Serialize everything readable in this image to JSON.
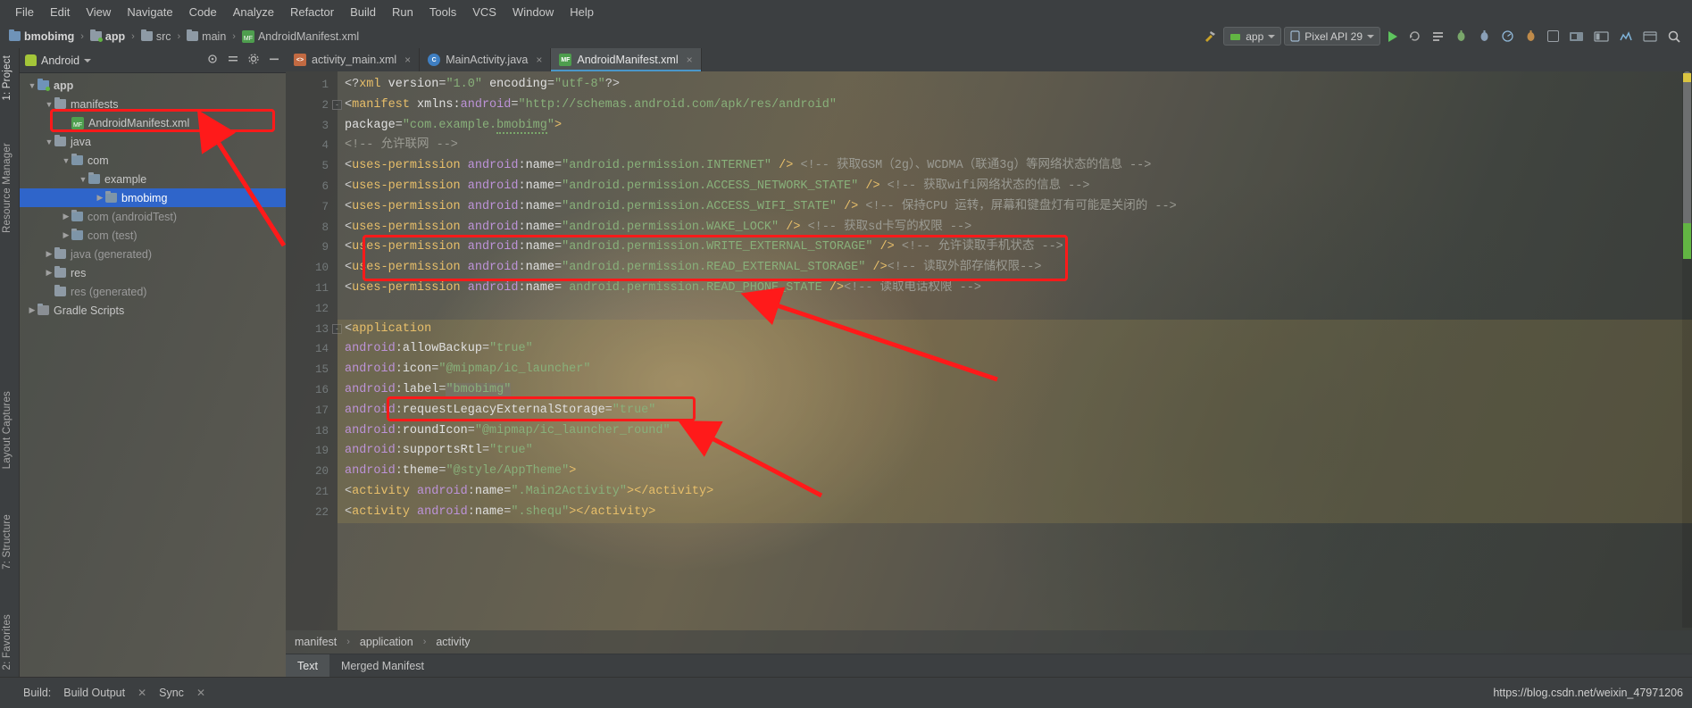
{
  "menu": {
    "items": [
      "File",
      "Edit",
      "View",
      "Navigate",
      "Code",
      "Analyze",
      "Refactor",
      "Build",
      "Run",
      "Tools",
      "VCS",
      "Window",
      "Help"
    ]
  },
  "breadcrumb": {
    "items": [
      "bmobimg",
      "app",
      "src",
      "main",
      "AndroidManifest.xml"
    ]
  },
  "toolbar": {
    "module_selector": "app",
    "device_selector": "Pixel API 29",
    "hammer_label": "build-icon",
    "run_label": "run-icon",
    "debug_label": "debug-icon",
    "search_label": "search-icon"
  },
  "left_strips": {
    "top": [
      "1: Project",
      "Resource Manager"
    ],
    "bottom": [
      "Layout Captures",
      "7: Structure",
      "2: Favorites"
    ]
  },
  "project_panel": {
    "title": "Android",
    "tree": [
      {
        "indent": 0,
        "arrow": "▼",
        "icon": "folder-blue",
        "label": "app",
        "bold": true,
        "selected": false
      },
      {
        "indent": 1,
        "arrow": "▼",
        "icon": "folder",
        "label": "manifests",
        "bold": false,
        "selected": false
      },
      {
        "indent": 2,
        "arrow": "",
        "icon": "manifest",
        "label": "AndroidManifest.xml",
        "bold": false,
        "selected": false
      },
      {
        "indent": 1,
        "arrow": "▼",
        "icon": "folder",
        "label": "java",
        "bold": false,
        "selected": false
      },
      {
        "indent": 2,
        "arrow": "▼",
        "icon": "package",
        "label": "com",
        "bold": false,
        "selected": false
      },
      {
        "indent": 3,
        "arrow": "▼",
        "icon": "package",
        "label": "example",
        "bold": false,
        "selected": false
      },
      {
        "indent": 4,
        "arrow": "▶",
        "icon": "package",
        "label": "bmobimg",
        "bold": false,
        "selected": true
      },
      {
        "indent": 2,
        "arrow": "▶",
        "icon": "package",
        "label": "com (androidTest)",
        "bold": false,
        "selected": false
      },
      {
        "indent": 2,
        "arrow": "▶",
        "icon": "package",
        "label": "com (test)",
        "bold": false,
        "selected": false
      },
      {
        "indent": 1,
        "arrow": "▶",
        "icon": "folder",
        "label": "java (generated)",
        "bold": false,
        "selected": false
      },
      {
        "indent": 1,
        "arrow": "▶",
        "icon": "folder",
        "label": "res",
        "bold": false,
        "selected": false
      },
      {
        "indent": 1,
        "arrow": "",
        "icon": "folder",
        "label": "res (generated)",
        "bold": false,
        "selected": false
      },
      {
        "indent": 0,
        "arrow": "▶",
        "icon": "gradle",
        "label": "Gradle Scripts",
        "bold": false,
        "selected": false
      }
    ]
  },
  "editor_tabs": [
    {
      "label": "activity_main.xml",
      "icon": "xml-icon",
      "active": false
    },
    {
      "label": "MainActivity.java",
      "icon": "java-icon",
      "active": false
    },
    {
      "label": "AndroidManifest.xml",
      "icon": "manifest-icon",
      "active": true
    }
  ],
  "code": {
    "lines": [
      {
        "n": 1,
        "highlight": false,
        "fold": "",
        "tokens": [
          {
            "t": "punc",
            "s": "<?"
          },
          {
            "t": "tag",
            "s": "xml"
          },
          {
            "t": "plain",
            "s": " "
          },
          {
            "t": "attr2",
            "s": "version"
          },
          {
            "t": "punc",
            "s": "="
          },
          {
            "t": "val",
            "s": "\"1.0\""
          },
          {
            "t": "plain",
            "s": " "
          },
          {
            "t": "attr2",
            "s": "encoding"
          },
          {
            "t": "punc",
            "s": "="
          },
          {
            "t": "val",
            "s": "\"utf-8\""
          },
          {
            "t": "punc",
            "s": "?>"
          }
        ]
      },
      {
        "n": 2,
        "highlight": false,
        "fold": "-",
        "tokens": [
          {
            "t": "punc",
            "s": "<"
          },
          {
            "t": "tag",
            "s": "manifest"
          },
          {
            "t": "plain",
            "s": " "
          },
          {
            "t": "attr2",
            "s": "xmlns:"
          },
          {
            "t": "attr",
            "s": "android"
          },
          {
            "t": "punc",
            "s": "="
          },
          {
            "t": "val",
            "s": "\"http://schemas.android.com/apk/res/android\""
          }
        ]
      },
      {
        "n": 3,
        "highlight": false,
        "fold": "",
        "indent": 1,
        "tokens": [
          {
            "t": "attr2",
            "s": "package"
          },
          {
            "t": "punc",
            "s": "="
          },
          {
            "t": "val",
            "s": "\"com.example."
          },
          {
            "t": "val-squig",
            "s": "bmobimg"
          },
          {
            "t": "val",
            "s": "\""
          },
          {
            "t": "tag",
            "s": ">"
          }
        ]
      },
      {
        "n": 4,
        "highlight": false,
        "fold": "",
        "indent": 1,
        "tokens": [
          {
            "t": "cmt",
            "s": "<!-- 允许联网 -->"
          }
        ]
      },
      {
        "n": 5,
        "highlight": false,
        "fold": "",
        "indent": 1,
        "tokens": [
          {
            "t": "punc",
            "s": "<"
          },
          {
            "t": "tag",
            "s": "uses-permission"
          },
          {
            "t": "plain",
            "s": " "
          },
          {
            "t": "attr",
            "s": "android"
          },
          {
            "t": "punc",
            "s": ":"
          },
          {
            "t": "attr2",
            "s": "name"
          },
          {
            "t": "punc",
            "s": "="
          },
          {
            "t": "val",
            "s": "\"android.permission.INTERNET\""
          },
          {
            "t": "plain",
            "s": " "
          },
          {
            "t": "tag",
            "s": "/>"
          },
          {
            "t": "plain",
            "s": " "
          },
          {
            "t": "cmt",
            "s": "<!-- 获取GSM（2g）、WCDMA（联通3g）等网络状态的信息 -->"
          }
        ]
      },
      {
        "n": 6,
        "highlight": false,
        "fold": "",
        "indent": 1,
        "tokens": [
          {
            "t": "punc",
            "s": "<"
          },
          {
            "t": "tag",
            "s": "uses-permission"
          },
          {
            "t": "plain",
            "s": " "
          },
          {
            "t": "attr",
            "s": "android"
          },
          {
            "t": "punc",
            "s": ":"
          },
          {
            "t": "attr2",
            "s": "name"
          },
          {
            "t": "punc",
            "s": "="
          },
          {
            "t": "val",
            "s": "\"android.permission.ACCESS_NETWORK_STATE\""
          },
          {
            "t": "plain",
            "s": " "
          },
          {
            "t": "tag",
            "s": "/>"
          },
          {
            "t": "plain",
            "s": " "
          },
          {
            "t": "cmt",
            "s": "<!-- 获取wifi网络状态的信息 -->"
          }
        ]
      },
      {
        "n": 7,
        "highlight": false,
        "fold": "",
        "indent": 1,
        "tokens": [
          {
            "t": "punc",
            "s": "<"
          },
          {
            "t": "tag",
            "s": "uses-permission"
          },
          {
            "t": "plain",
            "s": " "
          },
          {
            "t": "attr",
            "s": "android"
          },
          {
            "t": "punc",
            "s": ":"
          },
          {
            "t": "attr2",
            "s": "name"
          },
          {
            "t": "punc",
            "s": "="
          },
          {
            "t": "val",
            "s": "\"android.permission.ACCESS_WIFI_STATE\""
          },
          {
            "t": "plain",
            "s": " "
          },
          {
            "t": "tag",
            "s": "/>"
          },
          {
            "t": "plain",
            "s": " "
          },
          {
            "t": "cmt",
            "s": "<!-- 保持CPU 运转，屏幕和键盘灯有可能是关闭的 -->"
          }
        ]
      },
      {
        "n": 8,
        "highlight": false,
        "fold": "",
        "indent": 1,
        "tokens": [
          {
            "t": "punc",
            "s": "<"
          },
          {
            "t": "tag",
            "s": "uses-permission"
          },
          {
            "t": "plain",
            "s": " "
          },
          {
            "t": "attr",
            "s": "android"
          },
          {
            "t": "punc",
            "s": ":"
          },
          {
            "t": "attr2",
            "s": "name"
          },
          {
            "t": "punc",
            "s": "="
          },
          {
            "t": "val",
            "s": "\"android.permission.WAKE_LOCK\""
          },
          {
            "t": "plain",
            "s": " "
          },
          {
            "t": "tag",
            "s": "/>"
          },
          {
            "t": "plain",
            "s": " "
          },
          {
            "t": "cmt",
            "s": "<!-- 获取sd卡写的权限 -->"
          }
        ]
      },
      {
        "n": 9,
        "highlight": false,
        "fold": "",
        "indent": 1,
        "tokens": [
          {
            "t": "punc",
            "s": "<"
          },
          {
            "t": "tag",
            "s": "uses-permission"
          },
          {
            "t": "plain",
            "s": " "
          },
          {
            "t": "attr",
            "s": "android"
          },
          {
            "t": "punc",
            "s": ":"
          },
          {
            "t": "attr2",
            "s": "name"
          },
          {
            "t": "punc",
            "s": "="
          },
          {
            "t": "val",
            "s": "\"android.permission.WRITE_EXTERNAL_STORAGE\""
          },
          {
            "t": "plain",
            "s": " "
          },
          {
            "t": "tag",
            "s": "/>"
          },
          {
            "t": "plain",
            "s": " "
          },
          {
            "t": "cmt",
            "s": "<!-- 允许读取手机状态 -->"
          }
        ]
      },
      {
        "n": 10,
        "highlight": false,
        "fold": "",
        "indent": 1,
        "tokens": [
          {
            "t": "punc",
            "s": "<"
          },
          {
            "t": "tag",
            "s": "uses-permission"
          },
          {
            "t": "plain",
            "s": " "
          },
          {
            "t": "attr",
            "s": "android"
          },
          {
            "t": "punc",
            "s": ":"
          },
          {
            "t": "attr2",
            "s": "name"
          },
          {
            "t": "punc",
            "s": "="
          },
          {
            "t": "val",
            "s": "\"android.permission.READ_EXTERNAL_STORAGE\""
          },
          {
            "t": "plain",
            "s": " "
          },
          {
            "t": "tag",
            "s": "/>"
          },
          {
            "t": "cmt",
            "s": "<!-- 读取外部存储权限-->"
          }
        ]
      },
      {
        "n": 11,
        "highlight": false,
        "fold": "",
        "indent": 1,
        "tokens": [
          {
            "t": "punc",
            "s": "<"
          },
          {
            "t": "tag",
            "s": "uses-permission"
          },
          {
            "t": "plain",
            "s": " "
          },
          {
            "t": "attr",
            "s": "android"
          },
          {
            "t": "punc",
            "s": ":"
          },
          {
            "t": "attr2",
            "s": "name"
          },
          {
            "t": "punc",
            "s": "="
          },
          {
            "t": "val",
            "s": " android.permission.READ_PHONE_STATE "
          },
          {
            "t": "plain",
            "s": " "
          },
          {
            "t": "tag",
            "s": "/>"
          },
          {
            "t": "cmt",
            "s": "<!-- 读取电话权限 -->"
          }
        ]
      },
      {
        "n": 12,
        "highlight": false,
        "fold": "",
        "tokens": []
      },
      {
        "n": 13,
        "highlight": true,
        "fold": "-",
        "indent": 1,
        "tokens": [
          {
            "t": "punc",
            "s": "<"
          },
          {
            "t": "tag",
            "s": "application"
          }
        ]
      },
      {
        "n": 14,
        "highlight": true,
        "fold": "",
        "indent": 2,
        "tokens": [
          {
            "t": "attr",
            "s": "android"
          },
          {
            "t": "punc",
            "s": ":"
          },
          {
            "t": "attr2",
            "s": "allowBackup"
          },
          {
            "t": "punc",
            "s": "="
          },
          {
            "t": "val",
            "s": "\"true\""
          }
        ]
      },
      {
        "n": 15,
        "highlight": true,
        "fold": "",
        "indent": 2,
        "tokens": [
          {
            "t": "attr",
            "s": "android"
          },
          {
            "t": "punc",
            "s": ":"
          },
          {
            "t": "attr2",
            "s": "icon"
          },
          {
            "t": "punc",
            "s": "="
          },
          {
            "t": "val",
            "s": "\"@mipmap/ic_launcher\""
          }
        ]
      },
      {
        "n": 16,
        "highlight": true,
        "fold": "",
        "indent": 2,
        "tokens": [
          {
            "t": "attr",
            "s": "android"
          },
          {
            "t": "punc",
            "s": ":"
          },
          {
            "t": "attr2",
            "s": "label"
          },
          {
            "t": "punc",
            "s": "="
          },
          {
            "t": "hlval",
            "s": "\"bmobimg\""
          }
        ]
      },
      {
        "n": 17,
        "highlight": true,
        "fold": "",
        "indent": 2,
        "tokens": [
          {
            "t": "attr",
            "s": "android"
          },
          {
            "t": "punc",
            "s": ":"
          },
          {
            "t": "attr2",
            "s": "requestLegacyExternalStorage"
          },
          {
            "t": "punc",
            "s": "="
          },
          {
            "t": "val",
            "s": "\"true\""
          }
        ]
      },
      {
        "n": 18,
        "highlight": true,
        "fold": "",
        "indent": 2,
        "tokens": [
          {
            "t": "attr",
            "s": "android"
          },
          {
            "t": "punc",
            "s": ":"
          },
          {
            "t": "attr2",
            "s": "roundIcon"
          },
          {
            "t": "punc",
            "s": "="
          },
          {
            "t": "val",
            "s": "\"@mipmap/ic_launcher_round\""
          }
        ]
      },
      {
        "n": 19,
        "highlight": true,
        "fold": "",
        "indent": 2,
        "tokens": [
          {
            "t": "attr",
            "s": "android"
          },
          {
            "t": "punc",
            "s": ":"
          },
          {
            "t": "attr2",
            "s": "supportsRtl"
          },
          {
            "t": "punc",
            "s": "="
          },
          {
            "t": "val",
            "s": "\"true\""
          }
        ]
      },
      {
        "n": 20,
        "highlight": true,
        "fold": "",
        "indent": 2,
        "tokens": [
          {
            "t": "attr",
            "s": "android"
          },
          {
            "t": "punc",
            "s": ":"
          },
          {
            "t": "attr2",
            "s": "theme"
          },
          {
            "t": "punc",
            "s": "="
          },
          {
            "t": "val",
            "s": "\"@style/AppTheme\""
          },
          {
            "t": "tag",
            "s": ">"
          }
        ]
      },
      {
        "n": 21,
        "highlight": true,
        "fold": "",
        "indent": 2,
        "tokens": [
          {
            "t": "punc",
            "s": "<"
          },
          {
            "t": "tag",
            "s": "activity"
          },
          {
            "t": "plain",
            "s": " "
          },
          {
            "t": "attr",
            "s": "android"
          },
          {
            "t": "punc",
            "s": ":"
          },
          {
            "t": "attr2",
            "s": "name"
          },
          {
            "t": "punc",
            "s": "="
          },
          {
            "t": "val",
            "s": "\".Main2Activity\""
          },
          {
            "t": "tag",
            "s": ">"
          },
          {
            "t": "tag",
            "s": "</activity>"
          }
        ]
      },
      {
        "n": 22,
        "highlight": true,
        "fold": "",
        "indent": 2,
        "tokens": [
          {
            "t": "punc",
            "s": "<"
          },
          {
            "t": "tag",
            "s": "activity"
          },
          {
            "t": "plain",
            "s": " "
          },
          {
            "t": "attr",
            "s": "android"
          },
          {
            "t": "punc",
            "s": ":"
          },
          {
            "t": "attr2",
            "s": "name"
          },
          {
            "t": "punc",
            "s": "="
          },
          {
            "t": "val",
            "s": "\".shequ\""
          },
          {
            "t": "tag",
            "s": ">"
          },
          {
            "t": "tag",
            "s": "</activity>"
          }
        ]
      }
    ]
  },
  "bottom_breadcrumb": {
    "items": [
      "manifest",
      "application",
      "activity"
    ]
  },
  "view_tabs": [
    {
      "label": "Text",
      "active": true
    },
    {
      "label": "Merged Manifest",
      "active": false
    }
  ],
  "statusbar": {
    "build_label": "Build:",
    "build_output": "Build Output",
    "sync": "Sync",
    "url": "https://blog.csdn.net/weixin_47971206"
  },
  "colors": {
    "annotation_red": "#ff1a1a",
    "selection_blue": "#2f65ca",
    "tab_underline": "#4a97c9"
  }
}
